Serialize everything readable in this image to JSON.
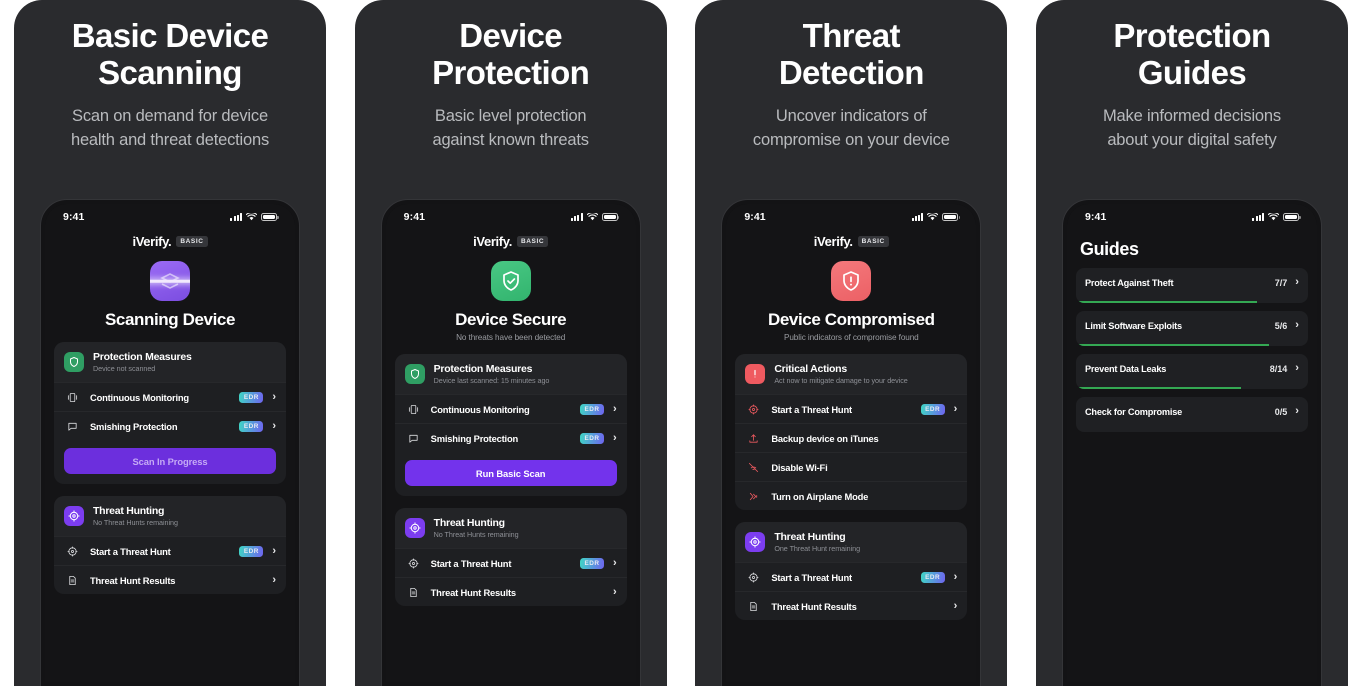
{
  "panels": [
    {
      "title": "Basic Device\nScanning",
      "subtitle": "Scan on demand for device\nhealth and threat detections",
      "screen": {
        "kind": "status",
        "status_time": "9:41",
        "brand_name": "iVerify.",
        "brand_badge": "BASIC",
        "hero_icon": "scanning-device-icon",
        "hero_icon_color": "#8d5cf0",
        "hero_title": "Scanning Device",
        "hero_sub": "",
        "cards": [
          {
            "icon": "shield-icon",
            "icon_color": "#2f9e63",
            "title": "Protection Measures",
            "sub": "Device not scanned",
            "rows": [
              {
                "icon": "monitor-icon",
                "label": "Continuous Monitoring",
                "badge": "EDR",
                "chevron": "›"
              },
              {
                "icon": "message-icon",
                "label": "Smishing Protection",
                "badge": "EDR",
                "chevron": "›"
              }
            ],
            "cta": {
              "label": "Scan In Progress",
              "state": "progress"
            }
          },
          {
            "icon": "target-icon",
            "icon_color": "#7c3df0",
            "title": "Threat Hunting",
            "sub": "No Threat Hunts remaining",
            "rows": [
              {
                "icon": "crosshair-icon",
                "label": "Start a Threat Hunt",
                "badge": "EDR",
                "chevron": "›"
              },
              {
                "icon": "document-icon",
                "label": "Threat Hunt Results",
                "badge": "",
                "chevron": "›"
              }
            ]
          }
        ]
      }
    },
    {
      "title": "Device\nProtection",
      "subtitle": "Basic level protection\nagainst known threats",
      "screen": {
        "kind": "status",
        "status_time": "9:41",
        "brand_name": "iVerify.",
        "brand_badge": "BASIC",
        "hero_icon": "shield-check-icon",
        "hero_icon_color": "#3cbd77",
        "hero_title": "Device Secure",
        "hero_sub": "No threats have been detected",
        "cards": [
          {
            "icon": "shield-icon",
            "icon_color": "#2f9e63",
            "title": "Protection Measures",
            "sub": "Device last scanned: 15 minutes ago",
            "rows": [
              {
                "icon": "monitor-icon",
                "label": "Continuous Monitoring",
                "badge": "EDR",
                "chevron": "›"
              },
              {
                "icon": "message-icon",
                "label": "Smishing Protection",
                "badge": "EDR",
                "chevron": "›"
              }
            ],
            "cta": {
              "label": "Run Basic Scan",
              "state": "active"
            }
          },
          {
            "icon": "target-icon",
            "icon_color": "#7c3df0",
            "title": "Threat Hunting",
            "sub": "No Threat Hunts remaining",
            "rows": [
              {
                "icon": "crosshair-icon",
                "label": "Start a Threat Hunt",
                "badge": "EDR",
                "chevron": "›"
              },
              {
                "icon": "document-icon",
                "label": "Threat Hunt Results",
                "badge": "",
                "chevron": "›"
              }
            ]
          }
        ]
      }
    },
    {
      "title": "Threat\nDetection",
      "subtitle": "Uncover indicators of\ncompromise on your device",
      "screen": {
        "kind": "status",
        "status_time": "9:41",
        "brand_name": "iVerify.",
        "brand_badge": "BASIC",
        "hero_icon": "shield-alert-icon",
        "hero_icon_color": "#ef5a60",
        "hero_title": "Device Compromised",
        "hero_sub": "Public indicators of compromise found",
        "cards": [
          {
            "icon": "alert-icon",
            "icon_color": "#ef5a60",
            "title": "Critical Actions",
            "sub": "Act now to mitigate damage to your device",
            "rows": [
              {
                "icon": "crosshair-icon",
                "icon_tone": "red",
                "label": "Start a Threat Hunt",
                "badge": "EDR",
                "chevron": "›"
              },
              {
                "icon": "upload-icon",
                "icon_tone": "red",
                "label": "Backup device on iTunes",
                "badge": "",
                "chevron": ""
              },
              {
                "icon": "wifi-off-icon",
                "icon_tone": "red",
                "label": "Disable Wi-Fi",
                "badge": "",
                "chevron": ""
              },
              {
                "icon": "airplane-icon",
                "icon_tone": "red",
                "label": "Turn on Airplane Mode",
                "badge": "",
                "chevron": ""
              }
            ]
          },
          {
            "icon": "target-icon",
            "icon_color": "#7c3df0",
            "title": "Threat Hunting",
            "sub": "One Threat Hunt remaining",
            "rows": [
              {
                "icon": "crosshair-icon",
                "label": "Start a Threat Hunt",
                "badge": "EDR",
                "chevron": "›"
              },
              {
                "icon": "document-icon",
                "label": "Threat Hunt Results",
                "badge": "",
                "chevron": "›"
              }
            ]
          }
        ]
      }
    },
    {
      "title": "Protection\nGuides",
      "subtitle": "Make informed decisions\nabout your digital safety",
      "screen": {
        "kind": "guides",
        "status_time": "9:41",
        "page_title": "Guides",
        "guides": [
          {
            "label": "Protect Against Theft",
            "count": "7/7",
            "progress_pct": 78,
            "chevron": "›"
          },
          {
            "label": "Limit Software Exploits",
            "count": "5/6",
            "progress_pct": 83,
            "chevron": "›"
          },
          {
            "label": "Prevent Data Leaks",
            "count": "8/14",
            "progress_pct": 71,
            "chevron": "›"
          },
          {
            "label": "Check for Compromise",
            "count": "0/5",
            "progress_pct": 0,
            "chevron": "›"
          }
        ]
      }
    }
  ],
  "colors": {
    "panel_bg": "#2a2b2e",
    "screen_bg": "#141416",
    "card_bg": "#1e1f22",
    "accent_purple": "#7333ec",
    "accent_green": "#34a853",
    "accent_red": "#ef5a60",
    "edr_gradient_from": "#3fd7c4",
    "edr_gradient_to": "#6f63f0",
    "text_primary": "#ffffff",
    "text_secondary": "#9a9ca1"
  }
}
